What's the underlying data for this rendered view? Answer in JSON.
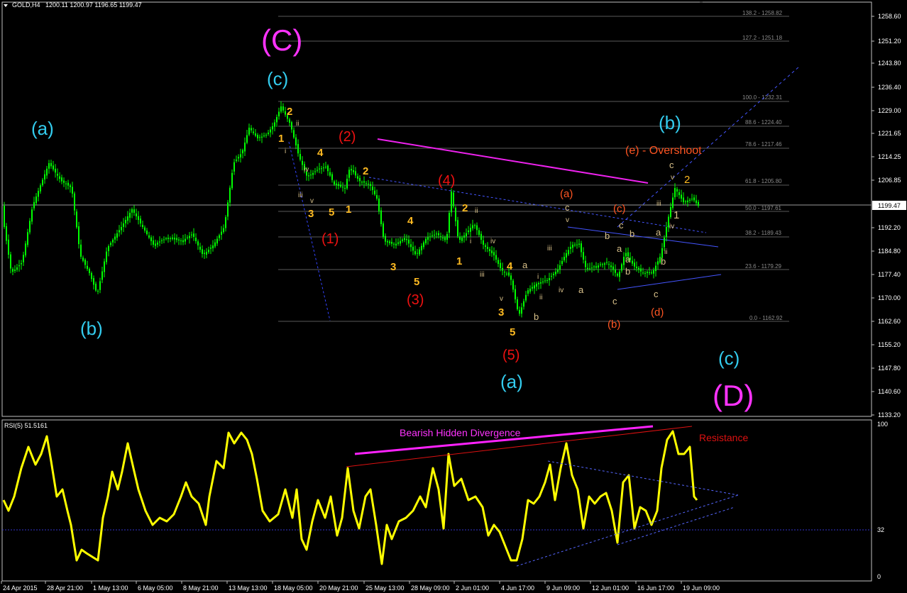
{
  "header": {
    "menu_arrow": "triangle-down-icon",
    "symbol": "GOLD,H4",
    "ohlc": "1200.11 1200.97 1196.65 1199.47"
  },
  "price_axis": {
    "ticks": [
      "1258.60",
      "1251.20",
      "1243.80",
      "1236.40",
      "1229.00",
      "1221.65",
      "1214.25",
      "1206.85",
      "1199.47",
      "1192.20",
      "1184.80",
      "1177.40",
      "1170.00",
      "1162.60",
      "1155.20",
      "1147.80",
      "1140.60",
      "1133.20"
    ],
    "current_price": "1199.47"
  },
  "fib_levels": [
    {
      "label": "138.2 - 1258.82"
    },
    {
      "label": "127.2 - 1251.18"
    },
    {
      "label": "100.0 - 1232.31"
    },
    {
      "label": "88.6 - 1224.40"
    },
    {
      "label": "78.6 - 1217.46"
    },
    {
      "label": "61.8 - 1205.80"
    },
    {
      "label": "50.0 - 1197.61"
    },
    {
      "label": "38.2 - 1189.43"
    },
    {
      "label": "23.6 - 1179.29"
    },
    {
      "label": "0.0 - 1162.92"
    }
  ],
  "wave_labels": {
    "big_C": "(C)",
    "big_D": "(D)",
    "cyan_a1": "(a)",
    "cyan_b1": "(b)",
    "cyan_c1": "(c)",
    "cyan_a2": "(a)",
    "cyan_b2": "(b)",
    "cyan_c2": "(c)",
    "red_1": "(1)",
    "red_2": "(2)",
    "red_3": "(3)",
    "red_4": "(4)",
    "red_5": "(5)",
    "orange_a": "(a)",
    "orange_b": "(b)",
    "orange_c": "(c)",
    "orange_d": "(d)",
    "overshoot": "(e) -  Overshoot",
    "n1": "1",
    "n2": "2",
    "n3": "3",
    "n4": "4",
    "n5": "5",
    "r_i": "i",
    "r_ii": "ii",
    "r_iii": "iii",
    "r_iv": "iv",
    "r_v": "v",
    "l_a": "a",
    "l_b": "b",
    "l_c": "c"
  },
  "indicator": {
    "title": "RSI(5) 51.5161",
    "axis_ticks": [
      "100",
      "32",
      "0"
    ],
    "divergence_label": "Bearish Hidden Divergence",
    "resistance_label": "Resistance"
  },
  "time_axis": {
    "labels": [
      "24 Apr 2015",
      "28 Apr 21:00",
      "1 May 13:00",
      "6 May 05:00",
      "8 May 21:00",
      "13 May 13:00",
      "18 May 05:00",
      "20 May 21:00",
      "25 May 13:00",
      "28 May 09:00",
      "2 Jun 01:00",
      "4 Jun 17:00",
      "9 Jun 09:00",
      "12 Jun 01:00",
      "16 Jun 17:00",
      "19 Jun 09:00"
    ]
  },
  "colors": {
    "background": "#000000",
    "candles": "#00ff00",
    "rsi_line": "#ffff00",
    "cyan_labels": "#33ccee",
    "magenta_labels": "#ff33ff",
    "red_labels": "#ff1111",
    "orange_labels": "#ff5522",
    "yellow_labels": "#ffbb22",
    "fib_lines": "#666666",
    "trend_blue": "#4444ff"
  },
  "chart_data": {
    "type": "candlestick",
    "title": "GOLD,H4",
    "ylim": [
      1133.2,
      1262.0
    ],
    "approx_close_path": [
      {
        "x": "24 Apr 2015",
        "close": 1192
      },
      {
        "x": "28 Apr 21:00",
        "close": 1210
      },
      {
        "x": "1 May 13:00",
        "close": 1175
      },
      {
        "x": "6 May 05:00",
        "close": 1193
      },
      {
        "x": "8 May 21:00",
        "close": 1185
      },
      {
        "x": "13 May 13:00",
        "close": 1220
      },
      {
        "x": "18 May 05:00",
        "close": 1225
      },
      {
        "x": "20 May 21:00",
        "close": 1208
      },
      {
        "x": "25 May 13:00",
        "close": 1187
      },
      {
        "x": "28 May 09:00",
        "close": 1188
      },
      {
        "x": "2 Jun 01:00",
        "close": 1190
      },
      {
        "x": "4 Jun 17:00",
        "close": 1165
      },
      {
        "x": "9 Jun 09:00",
        "close": 1185
      },
      {
        "x": "12 Jun 01:00",
        "close": 1180
      },
      {
        "x": "16 Jun 17:00",
        "close": 1180
      },
      {
        "x": "19 Jun 09:00",
        "close": 1199.47
      }
    ]
  }
}
